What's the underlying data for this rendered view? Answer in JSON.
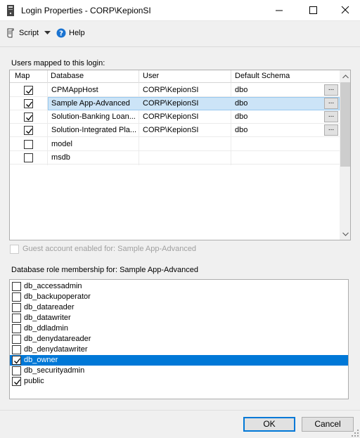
{
  "window": {
    "title": "Login Properties - CORP\\KepionSI"
  },
  "toolbar": {
    "script_label": "Script",
    "help_label": "Help"
  },
  "users": {
    "label": "Users mapped to this login:",
    "columns": [
      "Map",
      "Database",
      "User",
      "Default Schema"
    ],
    "rows": [
      {
        "map": true,
        "database": "CPMAppHost",
        "user": "CORP\\KepionSI",
        "schema": "dbo",
        "selected": false
      },
      {
        "map": true,
        "database": "Sample App-Advanced",
        "user": "CORP\\KepionSI",
        "schema": "dbo",
        "selected": true
      },
      {
        "map": true,
        "database": "Solution-Banking Loan...",
        "user": "CORP\\KepionSI",
        "schema": "dbo",
        "selected": false
      },
      {
        "map": true,
        "database": "Solution-Integrated Pla...",
        "user": "CORP\\KepionSI",
        "schema": "dbo",
        "selected": false
      },
      {
        "map": false,
        "database": "model",
        "user": "",
        "schema": "",
        "selected": false
      },
      {
        "map": false,
        "database": "msdb",
        "user": "",
        "schema": "",
        "selected": false
      }
    ],
    "browse_label": "..."
  },
  "guest": {
    "label": "Guest account enabled for: Sample App-Advanced",
    "checked": false
  },
  "roles": {
    "label": "Database role membership for: Sample App-Advanced",
    "items": [
      {
        "name": "db_accessadmin",
        "checked": false,
        "selected": false
      },
      {
        "name": "db_backupoperator",
        "checked": false,
        "selected": false
      },
      {
        "name": "db_datareader",
        "checked": false,
        "selected": false
      },
      {
        "name": "db_datawriter",
        "checked": false,
        "selected": false
      },
      {
        "name": "db_ddladmin",
        "checked": false,
        "selected": false
      },
      {
        "name": "db_denydatareader",
        "checked": false,
        "selected": false
      },
      {
        "name": "db_denydatawriter",
        "checked": false,
        "selected": false
      },
      {
        "name": "db_owner",
        "checked": true,
        "selected": true
      },
      {
        "name": "db_securityadmin",
        "checked": false,
        "selected": false
      },
      {
        "name": "public",
        "checked": true,
        "selected": false
      }
    ]
  },
  "buttons": {
    "ok_label": "OK",
    "cancel_label": "Cancel"
  },
  "colors": {
    "selection_blue": "#0078d7",
    "grid_selection": "#cce4f7"
  }
}
